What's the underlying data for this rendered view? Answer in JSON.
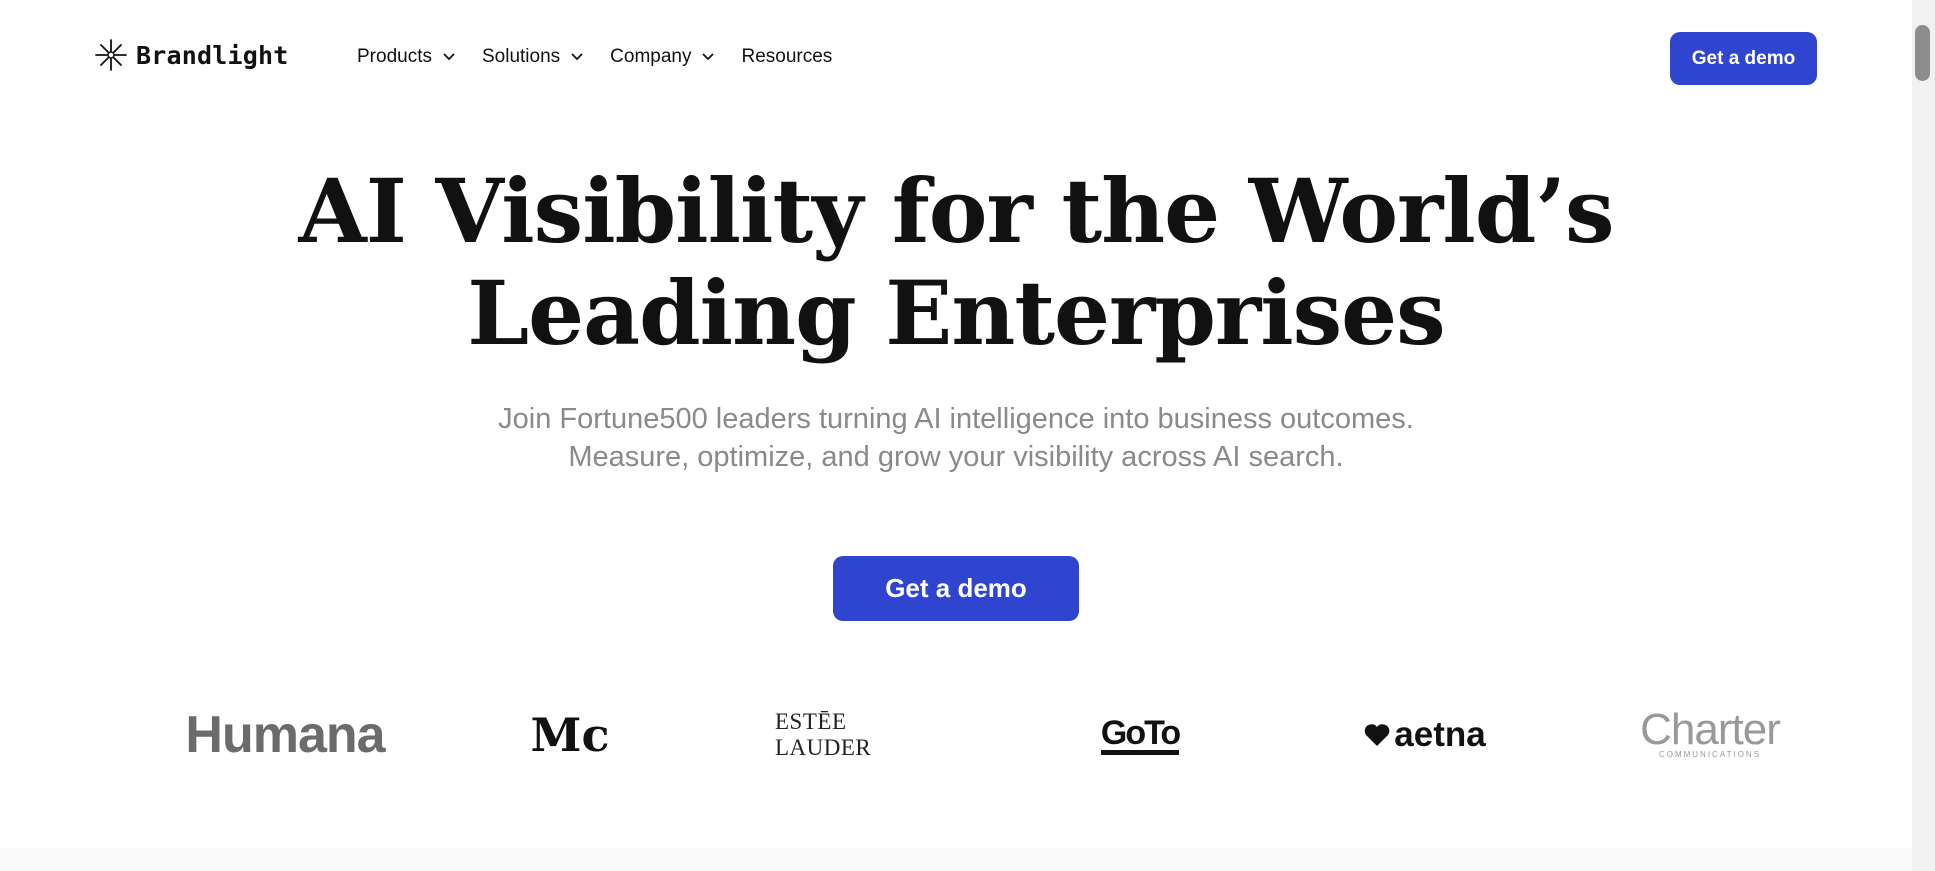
{
  "header": {
    "brand": "Brandlight",
    "nav": [
      {
        "label": "Products",
        "has_dropdown": true
      },
      {
        "label": "Solutions",
        "has_dropdown": true
      },
      {
        "label": "Company",
        "has_dropdown": true
      },
      {
        "label": "Resources",
        "has_dropdown": false
      }
    ],
    "cta_label": "Get a demo"
  },
  "hero": {
    "title_line1": "AI Visibility for the World’s",
    "title_line2": "Leading Enterprises",
    "subtitle_line1": "Join Fortune500 leaders turning AI intelligence into business outcomes.",
    "subtitle_line2": "Measure, optimize, and grow your visibility across AI search.",
    "cta_label": "Get a demo"
  },
  "logos": [
    {
      "name": "Humana",
      "text": "Humana"
    },
    {
      "name": "McCormick",
      "text": "Mc"
    },
    {
      "name": "Estee Lauder",
      "text": "ESTĒE LAUDER"
    },
    {
      "name": "GoTo",
      "text": "GoTo"
    },
    {
      "name": "Aetna",
      "text": "aetna"
    },
    {
      "name": "Charter Communications",
      "text": "Charter",
      "subtext": "COMMUNICATIONS"
    }
  ],
  "colors": {
    "accent": "#2f45cf",
    "subtitle": "#8a8a8a",
    "text": "#111111"
  }
}
